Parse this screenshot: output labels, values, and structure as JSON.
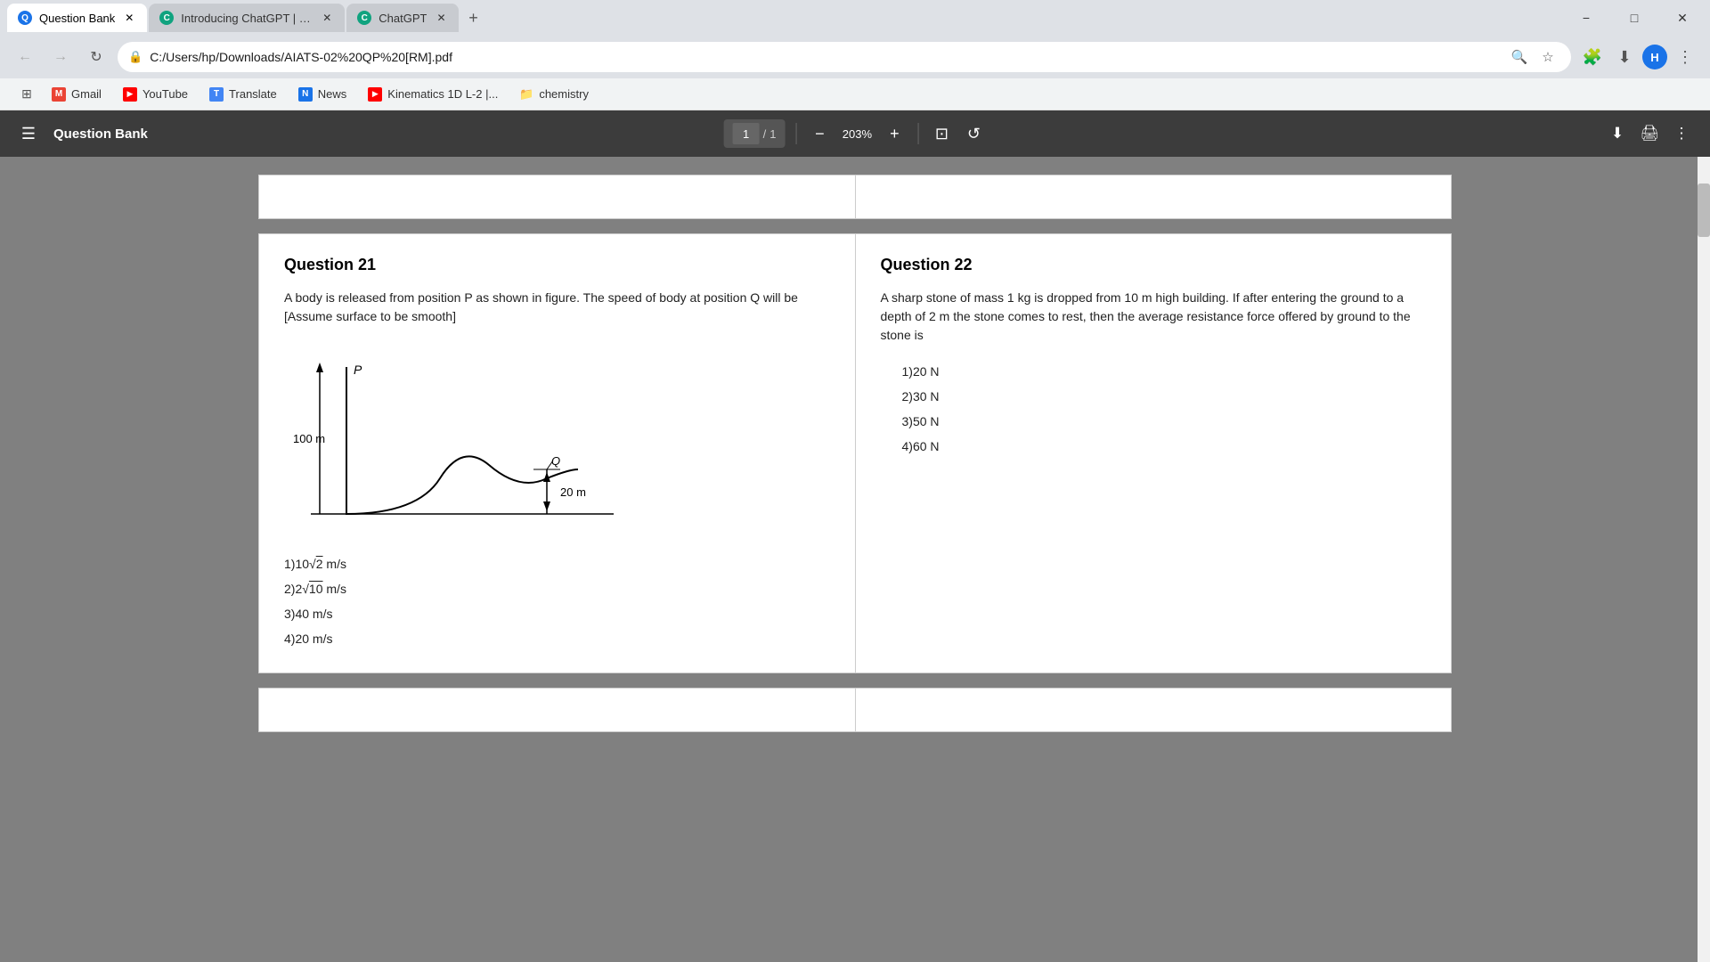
{
  "browser": {
    "tabs": [
      {
        "id": "tab1",
        "label": "Question Bank",
        "favicon_color": "#1a73e8",
        "active": true
      },
      {
        "id": "tab2",
        "label": "Introducing ChatGPT | OpenAI",
        "favicon_color": "#10a37f",
        "active": false
      },
      {
        "id": "tab3",
        "label": "ChatGPT",
        "favicon_color": "#10a37f",
        "active": false
      }
    ],
    "address": "C:/Users/hp/Downloads/AIATS-02%20QP%20[RM].pdf",
    "address_icon": "🔒"
  },
  "bookmarks": [
    {
      "label": "Gmail",
      "icon": "M"
    },
    {
      "label": "YouTube",
      "icon": "▶"
    },
    {
      "label": "Translate",
      "icon": "T"
    },
    {
      "label": "News",
      "icon": "N"
    },
    {
      "label": "Kinematics 1D L-2 |...",
      "icon": "▶"
    },
    {
      "label": "chemistry",
      "icon": "📁"
    }
  ],
  "pdf_toolbar": {
    "title": "Question Bank",
    "page_current": "1",
    "page_total": "1",
    "zoom": "203%"
  },
  "questions": [
    {
      "id": "q21",
      "number": "Question 21",
      "text": "A body is released from position P as shown in figure. The speed of body at position Q will be [Assume surface to be smooth]",
      "has_diagram": true,
      "options": [
        "1)10√2 m/s",
        "2)2√10 m/s",
        "3)40 m/s",
        "4)20 m/s"
      ]
    },
    {
      "id": "q22",
      "number": "Question 22",
      "text": "A sharp stone of mass 1 kg is dropped from 10 m high building. If after entering the ground to a depth of 2 m the stone comes to rest, then the average resistance force offered by ground to the stone is",
      "has_diagram": false,
      "options": [
        "1)20 N",
        "2)30 N",
        "3)50 N",
        "4)60 N"
      ]
    }
  ],
  "icons": {
    "menu": "☰",
    "back": "←",
    "forward": "→",
    "refresh": "↻",
    "search": "🔍",
    "star": "☆",
    "extensions": "🧩",
    "download": "⬇",
    "more": "⋮",
    "zoom_out": "−",
    "zoom_in": "+",
    "fit": "⊡",
    "rotate": "↺",
    "download_pdf": "⬇",
    "print": "🖨",
    "minimize": "−",
    "maximize": "□",
    "close": "✕",
    "new_tab": "+"
  }
}
